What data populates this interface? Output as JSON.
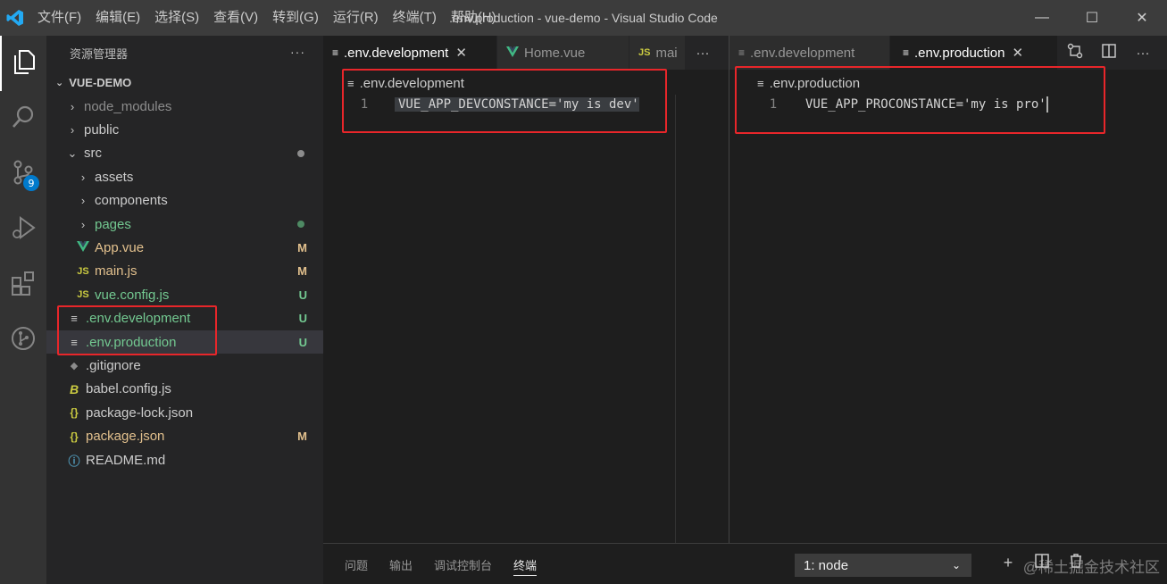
{
  "titlebar": {
    "menu": [
      "文件(F)",
      "编辑(E)",
      "选择(S)",
      "查看(V)",
      "转到(G)",
      "运行(R)",
      "终端(T)",
      "帮助(H)"
    ],
    "title": ".env.production - vue-demo - Visual Studio Code",
    "minimize": "—",
    "maximize": "☐",
    "close": "✕"
  },
  "activitybar": {
    "items": [
      "files-icon",
      "search-icon",
      "source-control-icon",
      "run-debug-icon",
      "extensions-icon",
      "git-graph-icon"
    ],
    "scm_badge": "9"
  },
  "sidebar": {
    "title": "资源管理器",
    "more": "···",
    "project": "VUE-DEMO",
    "items": [
      {
        "name": "node_modules",
        "kind": "folder",
        "status": ""
      },
      {
        "name": "public",
        "kind": "folder",
        "status": ""
      },
      {
        "name": "src",
        "kind": "folder-open",
        "status": ""
      },
      {
        "name": "assets",
        "kind": "folder",
        "status": ""
      },
      {
        "name": "components",
        "kind": "folder",
        "status": ""
      },
      {
        "name": "pages",
        "kind": "folder",
        "status": ""
      },
      {
        "name": "App.vue",
        "kind": "vue",
        "status": "M"
      },
      {
        "name": "main.js",
        "kind": "js",
        "status": "M"
      },
      {
        "name": "vue.config.js",
        "kind": "js",
        "status": "U"
      },
      {
        "name": ".env.development",
        "kind": "env",
        "status": "U"
      },
      {
        "name": ".env.production",
        "kind": "env",
        "status": "U"
      },
      {
        "name": ".gitignore",
        "kind": "git",
        "status": ""
      },
      {
        "name": "babel.config.js",
        "kind": "babel",
        "status": ""
      },
      {
        "name": "package-lock.json",
        "kind": "json",
        "status": ""
      },
      {
        "name": "package.json",
        "kind": "json",
        "status": "M"
      },
      {
        "name": "README.md",
        "kind": "info",
        "status": ""
      }
    ]
  },
  "editor_left": {
    "tabs": [
      {
        "label": ".env.development",
        "icon": "≡",
        "close": "✕"
      },
      {
        "label": "Home.vue",
        "icon": "V"
      },
      {
        "label": "mai",
        "icon": "JS"
      }
    ],
    "more": "···",
    "breadcrumb": ".env.development",
    "line_number": "1",
    "code": "VUE_APP_DEVCONSTANCE='my is dev'"
  },
  "editor_right": {
    "tabs": [
      {
        "label": ".env.development",
        "icon": "≡"
      },
      {
        "label": ".env.production",
        "icon": "≡",
        "close": "✕"
      }
    ],
    "breadcrumb": ".env.production",
    "line_number": "1",
    "code": "VUE_APP_PROCONSTANCE='my is pro'",
    "more": "···"
  },
  "panel": {
    "tabs": [
      "问题",
      "输出",
      "调试控制台",
      "终端"
    ],
    "active_tab": "终端",
    "terminal_select": "1: node",
    "add": "+",
    "watermark": "@稀土掘金技术社区"
  },
  "colors": {
    "highlight_box": "#e8262a",
    "accent": "#007acc"
  }
}
